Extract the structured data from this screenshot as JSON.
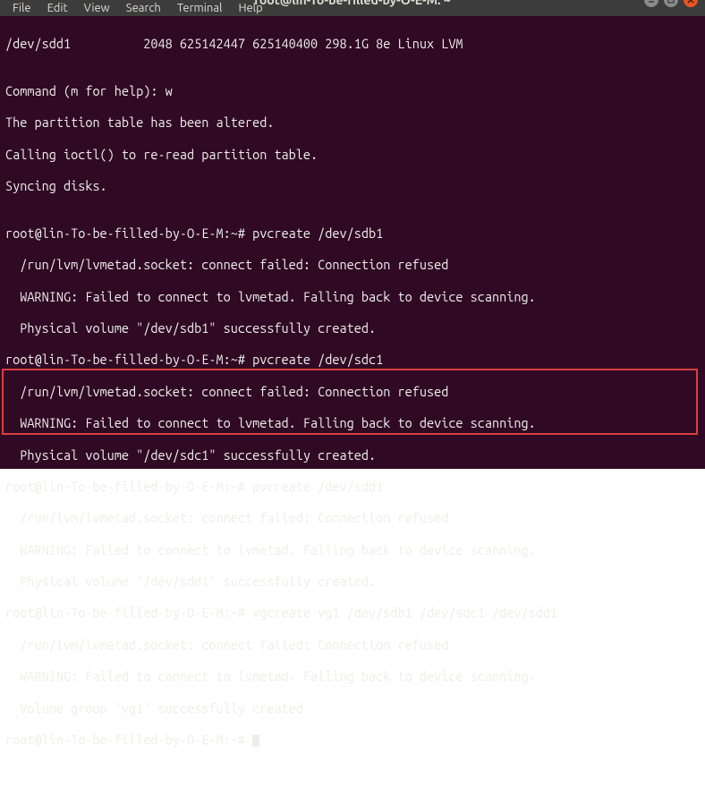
{
  "titlebar": {
    "title": "root@lin-To-be-filled-by-O-E-M: ~"
  },
  "menu": {
    "file": "File",
    "edit": "Edit",
    "view": "View",
    "search": "Search",
    "terminal": "Terminal",
    "help": "Help"
  },
  "lines": {
    "l0": "/dev/sdd1          2048 625142447 625140400 298.1G 8e Linux LVM",
    "l1": "",
    "l2": "Command (m for help): w",
    "l3": "The partition table has been altered.",
    "l4": "Calling ioctl() to re-read partition table.",
    "l5": "Syncing disks.",
    "l6": "",
    "l7": "root@lin-To-be-filled-by-O-E-M:~# pvcreate /dev/sdb1",
    "l8": "  /run/lvm/lvmetad.socket: connect failed: Connection refused",
    "l9": "  WARNING: Failed to connect to lvmetad. Falling back to device scanning.",
    "l10": "  Physical volume \"/dev/sdb1\" successfully created.",
    "l11": "root@lin-To-be-filled-by-O-E-M:~# pvcreate /dev/sdc1",
    "l12": "  /run/lvm/lvmetad.socket: connect failed: Connection refused",
    "l13": "  WARNING: Failed to connect to lvmetad. Falling back to device scanning.",
    "l14": "  Physical volume \"/dev/sdc1\" successfully created.",
    "l15": "root@lin-To-be-filled-by-O-E-M:~# pvcreate /dev/sdd1",
    "l16": "  /run/lvm/lvmetad.socket: connect failed: Connection refused",
    "l17": "  WARNING: Failed to connect to lvmetad. Falling back to device scanning.",
    "l18": "  Physical volume \"/dev/sdd1\" successfully created.",
    "l19": "root@lin-To-be-filled-by-O-E-M:~# vgcreate vg1 /dev/sdb1 /dev/sdc1 /dev/sdd1",
    "l20": "  /run/lvm/lvmetad.socket: connect failed: Connection refused",
    "l21": "  WARNING: Failed to connect to lvmetad. Falling back to device scanning.",
    "l22": "  Volume group \"vg1\" successfully created",
    "l23": "root@lin-To-be-filled-by-O-E-M:~# "
  }
}
